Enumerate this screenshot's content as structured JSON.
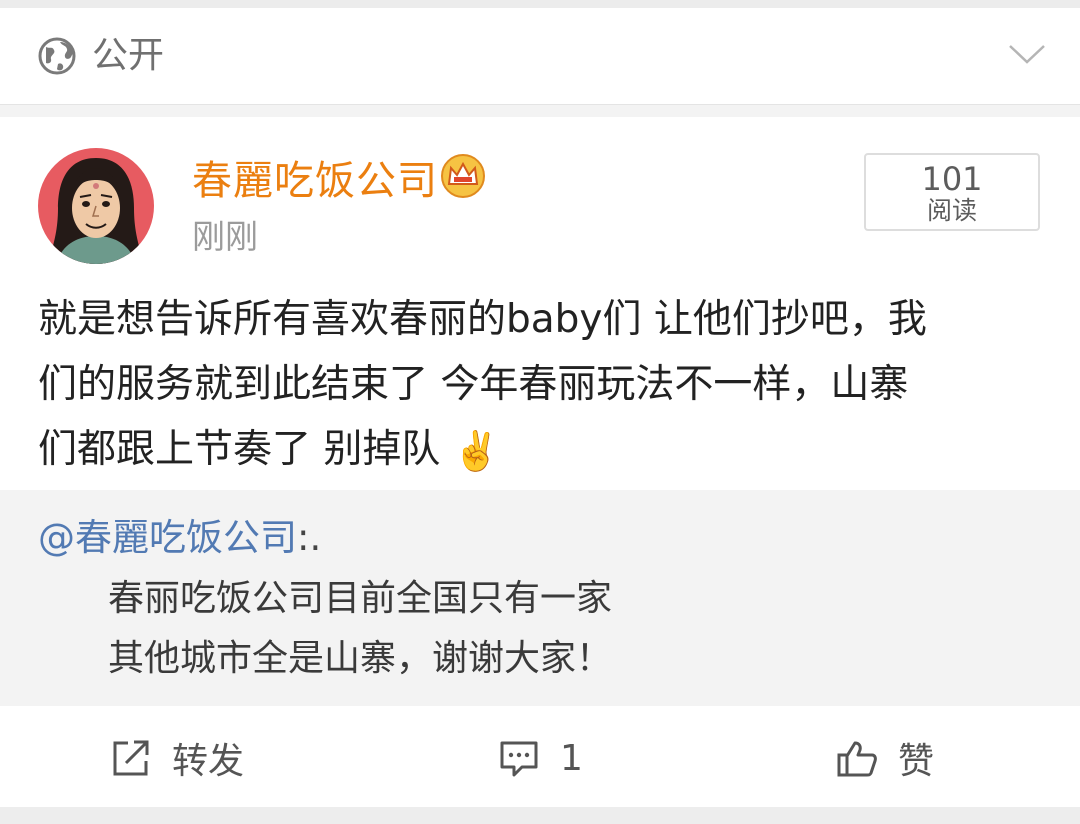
{
  "visibility": {
    "icon": "globe-icon",
    "label": "公开",
    "chevron": "chevron-down-icon"
  },
  "post": {
    "author": "春麗吃饭公司",
    "badge": "crown-icon",
    "timestamp": "刚刚",
    "read_count": "101",
    "read_label": "阅读",
    "text_lines": [
      "就是想告诉所有喜欢春丽的baby们 让他们抄吧，我",
      "们的服务就到此结束了 今年春丽玩法不一样，山寨",
      "们都跟上节奏了 别掉队"
    ],
    "emoji": "✌️"
  },
  "repost": {
    "author": "@春麗吃饭公司",
    "author_suffix": ":.",
    "lines": [
      "春丽吃饭公司目前全国只有一家",
      "其他城市全是山寨，谢谢大家！"
    ]
  },
  "actions": {
    "repost_label": "转发",
    "comment_count": "1",
    "like_label": "赞"
  },
  "colors": {
    "accent_name": "#eb7f10",
    "link": "#527ab3"
  }
}
